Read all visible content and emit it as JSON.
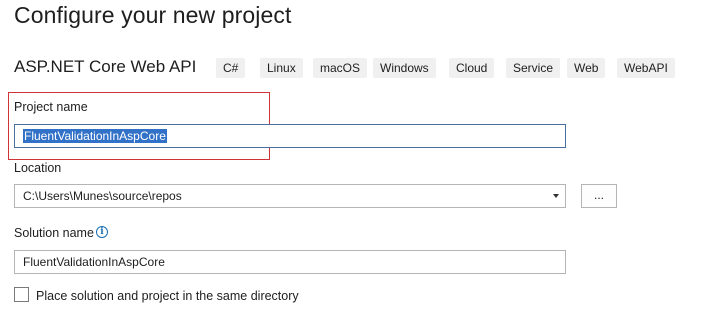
{
  "page_title": "Configure your new project",
  "template": {
    "name": "ASP.NET Core Web API",
    "tags": [
      "C#",
      "Linux",
      "macOS",
      "Windows",
      "Cloud",
      "Service",
      "Web",
      "WebAPI"
    ]
  },
  "project_name": {
    "label": "Project name",
    "value": "FluentValidationInAspCore"
  },
  "location": {
    "label": "Location",
    "value": "C:\\Users\\Munes\\source\\repos",
    "browse_label": "..."
  },
  "solution_name": {
    "label": "Solution name",
    "info_icon": "info-icon",
    "value": "FluentValidationInAspCore"
  },
  "same_directory": {
    "label": "Place solution and project in the same directory",
    "checked": false
  },
  "colors": {
    "highlight_border": "#d13438",
    "selection": "#3271c8",
    "info": "#1a6fb5"
  }
}
